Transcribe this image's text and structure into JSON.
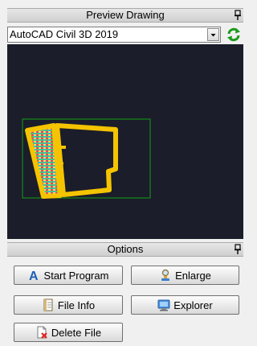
{
  "preview_panel": {
    "title": "Preview Drawing"
  },
  "version_select": {
    "selected": "AutoCAD Civil 3D 2019"
  },
  "options_panel": {
    "title": "Options"
  },
  "buttons": {
    "start_program": "Start Program",
    "enlarge": "Enlarge",
    "file_info": "File Info",
    "explorer": "Explorer",
    "delete_file": "Delete File"
  },
  "icons": {
    "pin": "pin-icon",
    "dropdown": "chevron-down-icon",
    "refresh": "refresh-icon",
    "start_program": "autocad-a-icon",
    "enlarge": "magnify-icon",
    "file_info": "document-icon",
    "explorer": "explorer-icon",
    "delete_file": "delete-file-icon"
  },
  "colors": {
    "preview_background": "#1b1d2a",
    "drawing_outline": "#f5c400",
    "extents_frame": "#12a012",
    "refresh_green": "#1a9a1a"
  }
}
